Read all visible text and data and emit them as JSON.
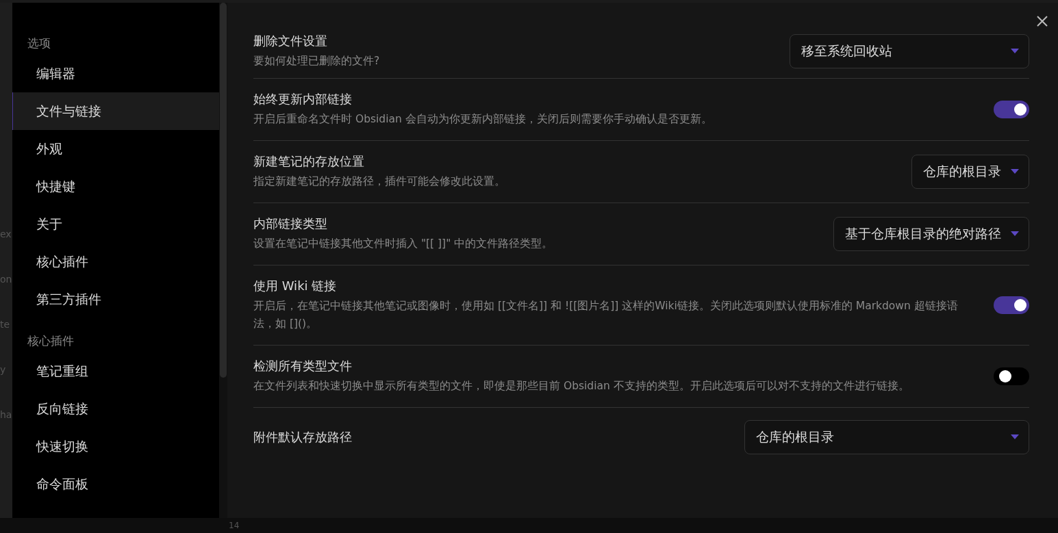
{
  "background": {
    "fragments": [
      "ex",
      "on",
      "te",
      "y",
      "ha"
    ],
    "line_number": "14"
  },
  "sidebar": {
    "sections": [
      {
        "heading": "选项",
        "items": [
          {
            "label": "编辑器",
            "selected": false
          },
          {
            "label": "文件与链接",
            "selected": true
          },
          {
            "label": "外观",
            "selected": false
          },
          {
            "label": "快捷键",
            "selected": false
          },
          {
            "label": "关于",
            "selected": false
          },
          {
            "label": "核心插件",
            "selected": false
          },
          {
            "label": "第三方插件",
            "selected": false
          }
        ]
      },
      {
        "heading": "核心插件",
        "items": [
          {
            "label": "笔记重组",
            "selected": false
          },
          {
            "label": "反向链接",
            "selected": false
          },
          {
            "label": "快速切换",
            "selected": false
          },
          {
            "label": "命令面板",
            "selected": false
          }
        ]
      }
    ]
  },
  "settings": [
    {
      "kind": "dropdown",
      "title": "删除文件设置",
      "description": "要如何处理已删除的文件?",
      "value": "移至系统回收站"
    },
    {
      "kind": "toggle",
      "title": "始终更新内部链接",
      "description": "开启后重命名文件时 Obsidian 会自动为你更新内部链接，关闭后则需要你手动确认是否更新。",
      "on": true
    },
    {
      "kind": "dropdown",
      "title": "新建笔记的存放位置",
      "description": "指定新建笔记的存放路径，插件可能会修改此设置。",
      "value": "仓库的根目录"
    },
    {
      "kind": "dropdown",
      "title": "内部链接类型",
      "description": "设置在笔记中链接其他文件时插入 \"[[ ]]\" 中的文件路径类型。",
      "value": "基于仓库根目录的绝对路径"
    },
    {
      "kind": "toggle",
      "title": "使用 Wiki 链接",
      "description": "开启后，在笔记中链接其他笔记或图像时，使用如 [[文件名]] 和 ![[图片名]] 这样的Wiki链接。关闭此选项则默认使用标准的 Markdown 超链接语法，如 []()。",
      "on": true
    },
    {
      "kind": "toggle",
      "title": "检测所有类型文件",
      "description": "在文件列表和快速切换中显示所有类型的文件，即使是那些目前 Obsidian 不支持的类型。开启此选项后可以对不支持的文件进行链接。",
      "on": false
    },
    {
      "kind": "dropdown",
      "title": "附件默认存放路径",
      "value": "仓库的根目录"
    }
  ]
}
